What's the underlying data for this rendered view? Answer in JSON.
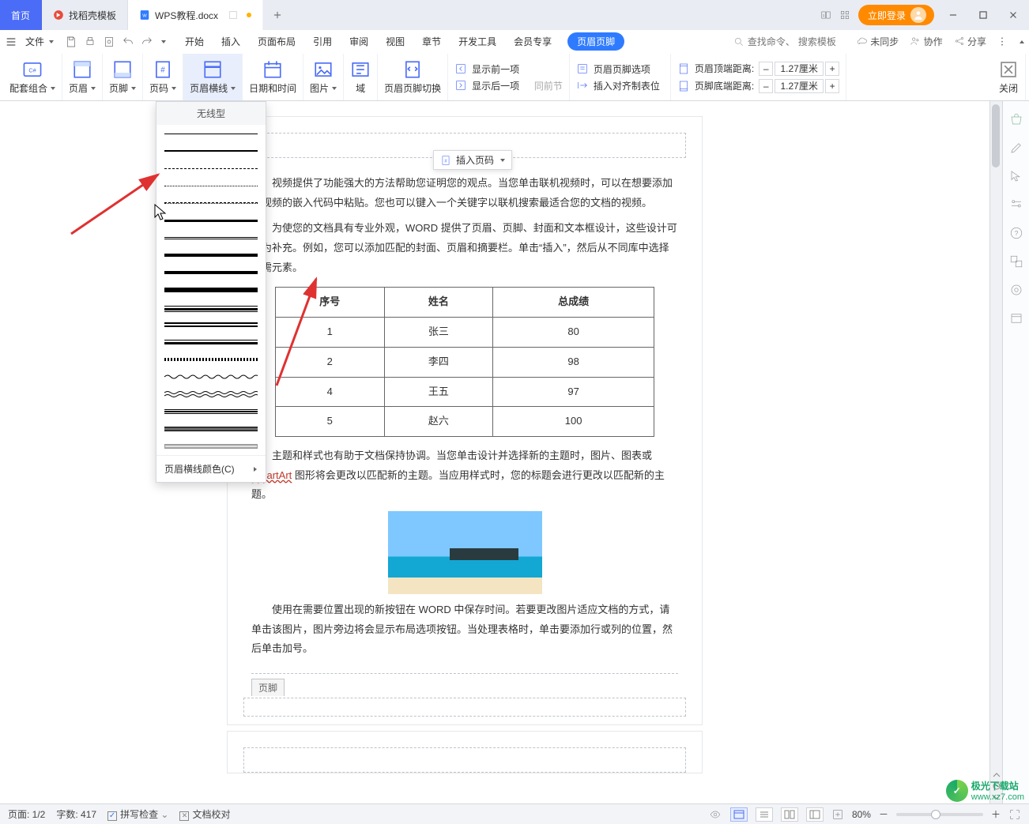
{
  "colors": {
    "accent": "#2f7bff",
    "orange": "#ff8a00"
  },
  "titlebar": {
    "home": "首页",
    "template_tab": "找稻壳模板",
    "doc_tab": "WPS教程.docx",
    "login": "立即登录"
  },
  "menurow": {
    "file": "文件",
    "menus": [
      "开始",
      "插入",
      "页面布局",
      "引用",
      "审阅",
      "视图",
      "章节",
      "开发工具",
      "会员专享",
      "页眉页脚"
    ],
    "active_index": 9,
    "search_placeholder_cmd": "查找命令、",
    "search_placeholder_tpl": "搜索模板",
    "unsync": "未同步",
    "coop": "协作",
    "share": "分享"
  },
  "ribbon": {
    "combo": "配套组合",
    "header": "页眉",
    "footer": "页脚",
    "pagenum": "页码",
    "hline": "页眉横线",
    "datetime": "日期和时间",
    "picture": "图片",
    "field": "域",
    "hf_switch": "页眉页脚切换",
    "show_prev": "显示前一项",
    "show_next": "显示后一项",
    "same_prev": "同前节",
    "hf_options": "页眉页脚选项",
    "insert_align": "插入对齐制表位",
    "top_dist_label": "页眉顶端距离:",
    "bot_dist_label": "页脚底端距离:",
    "dist_value": "1.27厘米",
    "close": "关闭"
  },
  "dropdown": {
    "title": "无线型",
    "footer": "页眉横线颜色(C)"
  },
  "doc": {
    "p1": "视频提供了功能强大的方法帮助您证明您的观点。当您单击联机视频时，可以在想要添加的视频的嵌入代码中粘贴。您也可以键入一个关键字以联机搜索最适合您的文档的视频。",
    "p2": "为使您的文档具有专业外观，WORD 提供了页眉、页脚、封面和文本框设计，这些设计可互为补充。例如，您可以添加匹配的封面、页眉和摘要栏。单击“插入”，然后从不同库中选择所需元素。",
    "p3a": "主题和样式也有助于文档保持协调。当您单击设计并选择新的主题时，图片、图表或 ",
    "smartart": "SmartArt",
    "p3b": " 图形将会更改以匹配新的主题。当应用样式时，您的标题会进行更改以匹配新的主题。",
    "p4": "使用在需要位置出现的新按钮在 WORD 中保存时间。若要更改图片适应文档的方式，请单击该图片，图片旁边将会显示布局选项按钮。当处理表格时，单击要添加行或列的位置，然后单击加号。",
    "insert_pagenum": "插入页码",
    "footer_label": "页脚",
    "table": {
      "headers": [
        "序号",
        "姓名",
        "总成绩"
      ],
      "rows": [
        [
          "1",
          "张三",
          "80"
        ],
        [
          "2",
          "李四",
          "98"
        ],
        [
          "4",
          "王五",
          "97"
        ],
        [
          "5",
          "赵六",
          "100"
        ]
      ]
    }
  },
  "status": {
    "page": "页面: 1/2",
    "words": "字数: 417",
    "spell": "拼写检查",
    "proof": "文档校对",
    "zoom": "80%"
  },
  "watermark": {
    "site": "极光下载站",
    "url": "www.xz7.com"
  }
}
